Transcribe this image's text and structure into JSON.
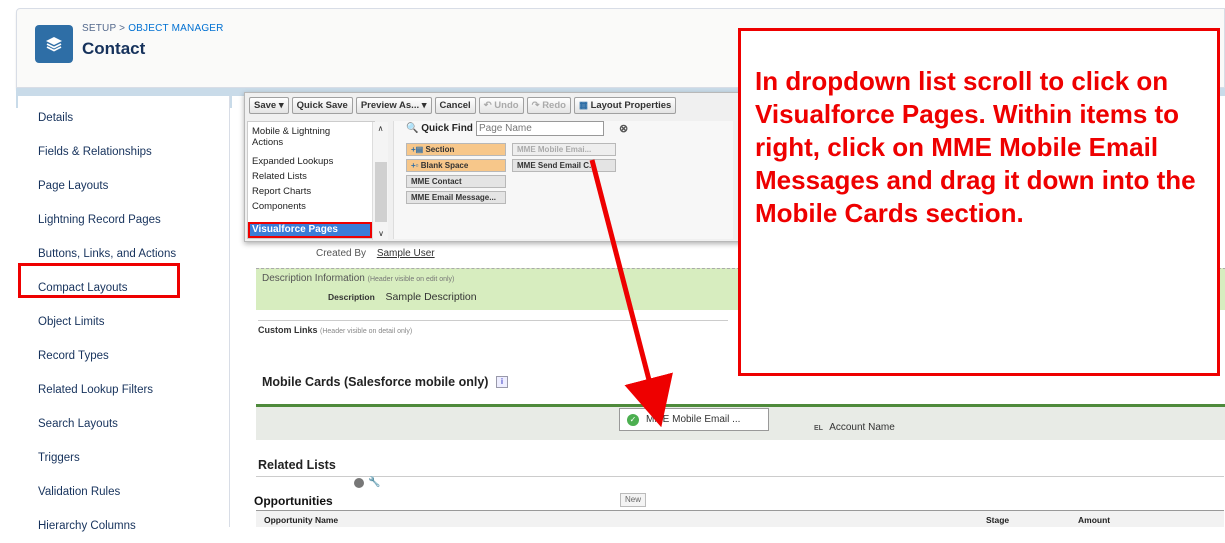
{
  "header": {
    "breadcrumb_setup": "SETUP",
    "breadcrumb_sep": ">",
    "breadcrumb_object": "OBJECT MANAGER",
    "title": "Contact"
  },
  "sidebar": {
    "items": [
      {
        "label": "Details"
      },
      {
        "label": "Fields & Relationships"
      },
      {
        "label": "Page Layouts"
      },
      {
        "label": "Lightning Record Pages"
      },
      {
        "label": "Buttons, Links, and Actions"
      },
      {
        "label": "Compact Layouts"
      },
      {
        "label": "Object Limits"
      },
      {
        "label": "Record Types"
      },
      {
        "label": "Related Lookup Filters"
      },
      {
        "label": "Search Layouts"
      },
      {
        "label": "Triggers"
      },
      {
        "label": "Validation Rules"
      },
      {
        "label": "Hierarchy Columns"
      }
    ]
  },
  "toolbar": {
    "save": "Save",
    "quick_save": "Quick Save",
    "preview": "Preview As...",
    "cancel": "Cancel",
    "undo": "Undo",
    "redo": "Redo",
    "layout_properties": "Layout Properties"
  },
  "palette": {
    "categories": [
      "Mobile & Lightning Actions",
      "Expanded Lookups",
      "Related Lists",
      "Report Charts",
      "Components"
    ],
    "selected_category": "Visualforce Pages",
    "quick_find_label": "Quick Find",
    "quick_find_placeholder": "Page Name",
    "items": {
      "section": "Section",
      "blank_space": "Blank Space",
      "mme_contact": "MME Contact",
      "mme_email_message": "MME Email Message...",
      "mme_mobile_email": "MME Mobile Emai...",
      "mme_send_email": "MME Send Email C..."
    }
  },
  "layout": {
    "created_by_label": "Created By",
    "created_by_value": "Sample User",
    "desc_section_title": "Description Information",
    "desc_section_note": "(Header visible on edit only)",
    "desc_label": "Description",
    "desc_value": "Sample Description",
    "custom_links_title": "Custom Links",
    "custom_links_note": "(Header visible on detail only)",
    "mobile_cards_title": "Mobile Cards (Salesforce mobile only)",
    "mobile_card_item": "MME Mobile Email ...",
    "account_name": "Account Name",
    "account_badge": "EL",
    "related_lists_title": "Related Lists",
    "opportunities_title": "Opportunities",
    "new_button": "New",
    "col_name": "Opportunity Name",
    "col_stage": "Stage",
    "col_amount": "Amount"
  },
  "annotation": {
    "text": "In dropdown list scroll to click on Visualforce Pages. Within items to right, click on MME Mobile Email Messages and drag it down into the Mobile Cards section."
  },
  "colors": {
    "highlight": "#e00000",
    "section_green": "#d7edbf",
    "brand_blue": "#2e6ea6"
  }
}
